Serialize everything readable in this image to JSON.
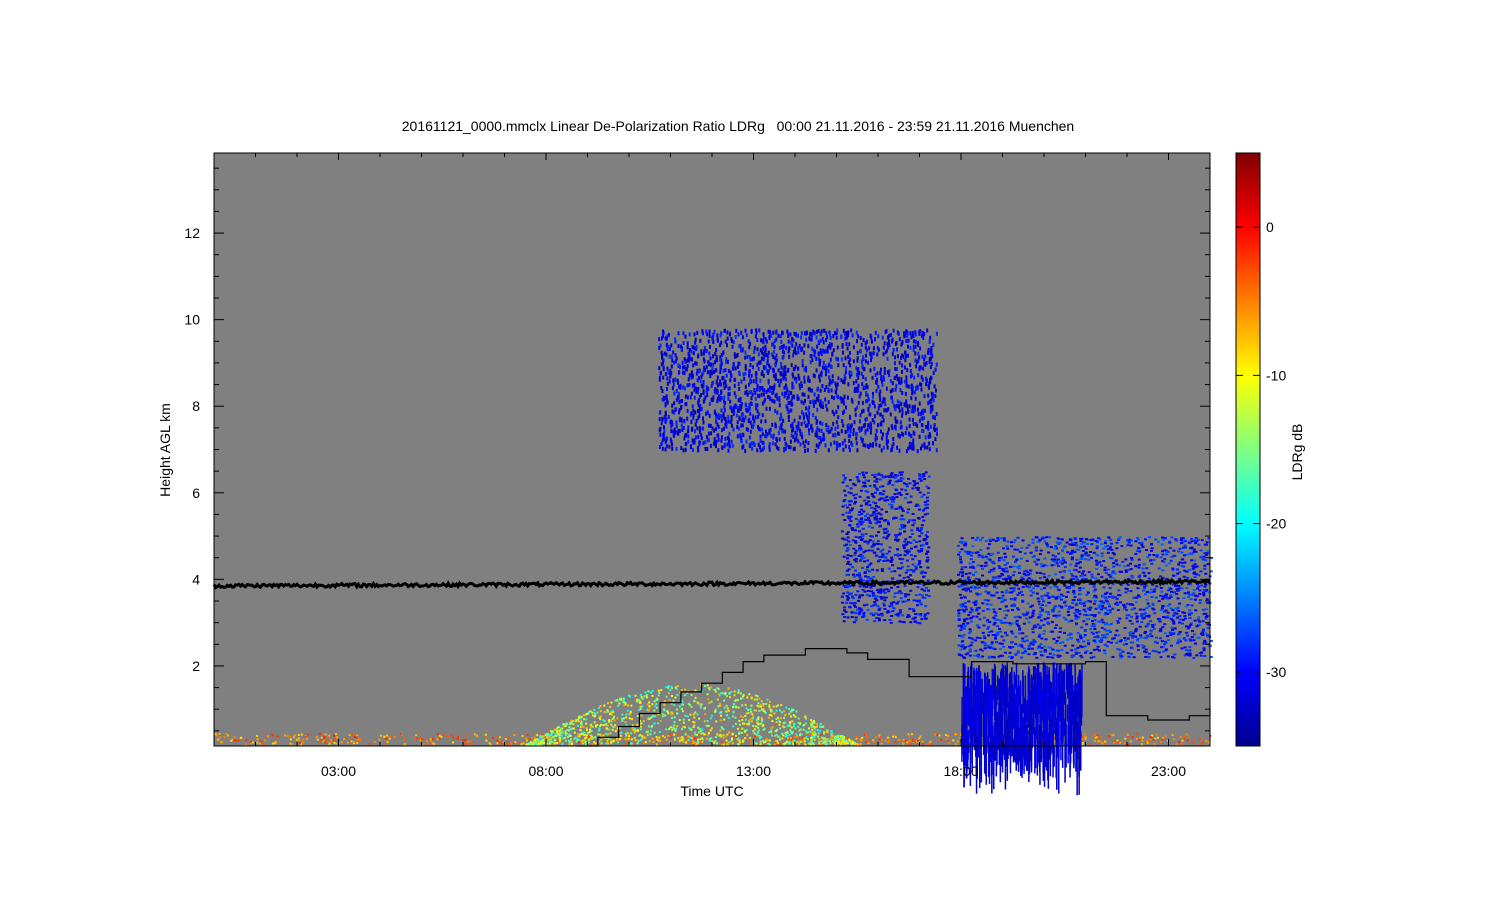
{
  "chart_data": {
    "type": "heatmap",
    "title": "20161121_0000.mmclx Linear De-Polarization Ratio LDRg   00:00 21.11.2016 - 23:59 21.11.2016 Muenchen",
    "xlabel": "Time UTC",
    "ylabel": "Height AGL km",
    "xlim": [
      0,
      24
    ],
    "ylim": [
      0.15,
      13.85
    ],
    "x_ticks": [
      {
        "value": 3,
        "label": "03:00"
      },
      {
        "value": 8,
        "label": "08:00"
      },
      {
        "value": 13,
        "label": "13:00"
      },
      {
        "value": 18,
        "label": "18:00"
      },
      {
        "value": 23,
        "label": "23:00"
      }
    ],
    "y_ticks": [
      {
        "value": 2,
        "label": "2"
      },
      {
        "value": 4,
        "label": "4"
      },
      {
        "value": 6,
        "label": "6"
      },
      {
        "value": 8,
        "label": "8"
      },
      {
        "value": 10,
        "label": "10"
      },
      {
        "value": 12,
        "label": "12"
      }
    ],
    "colorbar": {
      "label": "LDRg dB",
      "range": [
        -35,
        5
      ],
      "ticks": [
        {
          "value": 0,
          "label": "0"
        },
        {
          "value": -10,
          "label": "-10"
        },
        {
          "value": -20,
          "label": "-20"
        },
        {
          "value": -30,
          "label": "-30"
        }
      ],
      "colormap": [
        "#00008f",
        "#0000ff",
        "#0080ff",
        "#00ffff",
        "#80ff80",
        "#ffff00",
        "#ff8000",
        "#ff0000",
        "#800000"
      ]
    },
    "background_color": "#808080",
    "overlay_line": {
      "color": "#000000",
      "points": [
        [
          0,
          3.85
        ],
        [
          24,
          3.95
        ]
      ]
    },
    "step_line": {
      "color": "#000000",
      "steps": [
        [
          8.75,
          0.15
        ],
        [
          9.25,
          0.35
        ],
        [
          9.75,
          0.6
        ],
        [
          10.25,
          0.9
        ],
        [
          10.75,
          1.15
        ],
        [
          11.25,
          1.4
        ],
        [
          11.75,
          1.6
        ],
        [
          12.25,
          1.85
        ],
        [
          12.75,
          2.1
        ],
        [
          13.25,
          2.25
        ],
        [
          14.25,
          2.4
        ],
        [
          15.25,
          2.3
        ],
        [
          15.75,
          2.15
        ],
        [
          16.75,
          1.75
        ],
        [
          17.75,
          1.75
        ],
        [
          18.25,
          2.1
        ],
        [
          19.25,
          2.05
        ],
        [
          21.0,
          2.1
        ],
        [
          21.5,
          0.85
        ],
        [
          22.5,
          0.75
        ],
        [
          23.5,
          0.85
        ],
        [
          24.0,
          1.05
        ]
      ]
    },
    "features": [
      {
        "name": "low-level clutter",
        "time": [
          0,
          24
        ],
        "height": [
          0.2,
          0.45
        ],
        "ldr_db": -5
      },
      {
        "name": "boundary-layer scatter",
        "time": [
          7.5,
          15.5
        ],
        "height": [
          0.2,
          1.6
        ],
        "ldr_db": -13
      },
      {
        "name": "ice cloud",
        "time": [
          15.1,
          17.2
        ],
        "height": [
          3.0,
          6.5
        ],
        "ldr_db": -30
      },
      {
        "name": "cloud layer",
        "time": [
          17.9,
          24
        ],
        "height": [
          2.2,
          5.0
        ],
        "ldr_db": -29
      },
      {
        "name": "precipitation streaks",
        "time": [
          18.0,
          20.9
        ],
        "height": [
          0.15,
          2.1
        ],
        "ldr_db": -32
      },
      {
        "name": "high cirrus fall streaks",
        "time": [
          10.7,
          17.4
        ],
        "height": [
          7.0,
          9.8
        ],
        "ldr_db": -31
      }
    ]
  }
}
